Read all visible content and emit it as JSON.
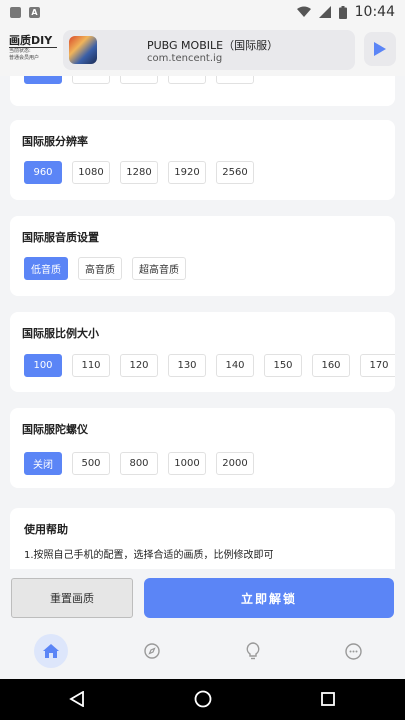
{
  "status_bar": {
    "time": "10:44"
  },
  "header": {
    "brand_title": "画质DIY",
    "brand_status_label": "当前状态:",
    "brand_status_value": "普通会员用户",
    "game_title": "PUBG MOBILE（国际服）",
    "game_package": "com.tencent.ig"
  },
  "sections": {
    "fps": {
      "options": [
        "",
        "",
        "",
        "",
        ""
      ]
    },
    "resolution": {
      "title": "国际服分辨率",
      "options": [
        "960",
        "1080",
        "1280",
        "1920",
        "2560"
      ],
      "selected": "960"
    },
    "audio": {
      "title": "国际服音质设置",
      "options": [
        "低音质",
        "高音质",
        "超高音质"
      ],
      "selected": "低音质"
    },
    "ratio": {
      "title": "国际服比例大小",
      "options": [
        "100",
        "110",
        "120",
        "130",
        "140",
        "150",
        "160",
        "170"
      ],
      "selected": "100"
    },
    "gyro": {
      "title": "国际服陀螺仪",
      "options": [
        "关闭",
        "500",
        "800",
        "1000",
        "2000"
      ],
      "selected": "关闭"
    },
    "help": {
      "title": "使用帮助",
      "line1": "1.按照自己手机的配置，选择合适的画质，比例修改即可"
    }
  },
  "actions": {
    "reset_label": "重置画质",
    "unlock_label": "立即解锁"
  },
  "nav": {
    "items": [
      "home-icon",
      "compass-icon",
      "bulb-icon",
      "more-icon"
    ],
    "active": "home-icon"
  },
  "colors": {
    "accent": "#5b85f6",
    "background": "#f3f4f6"
  }
}
